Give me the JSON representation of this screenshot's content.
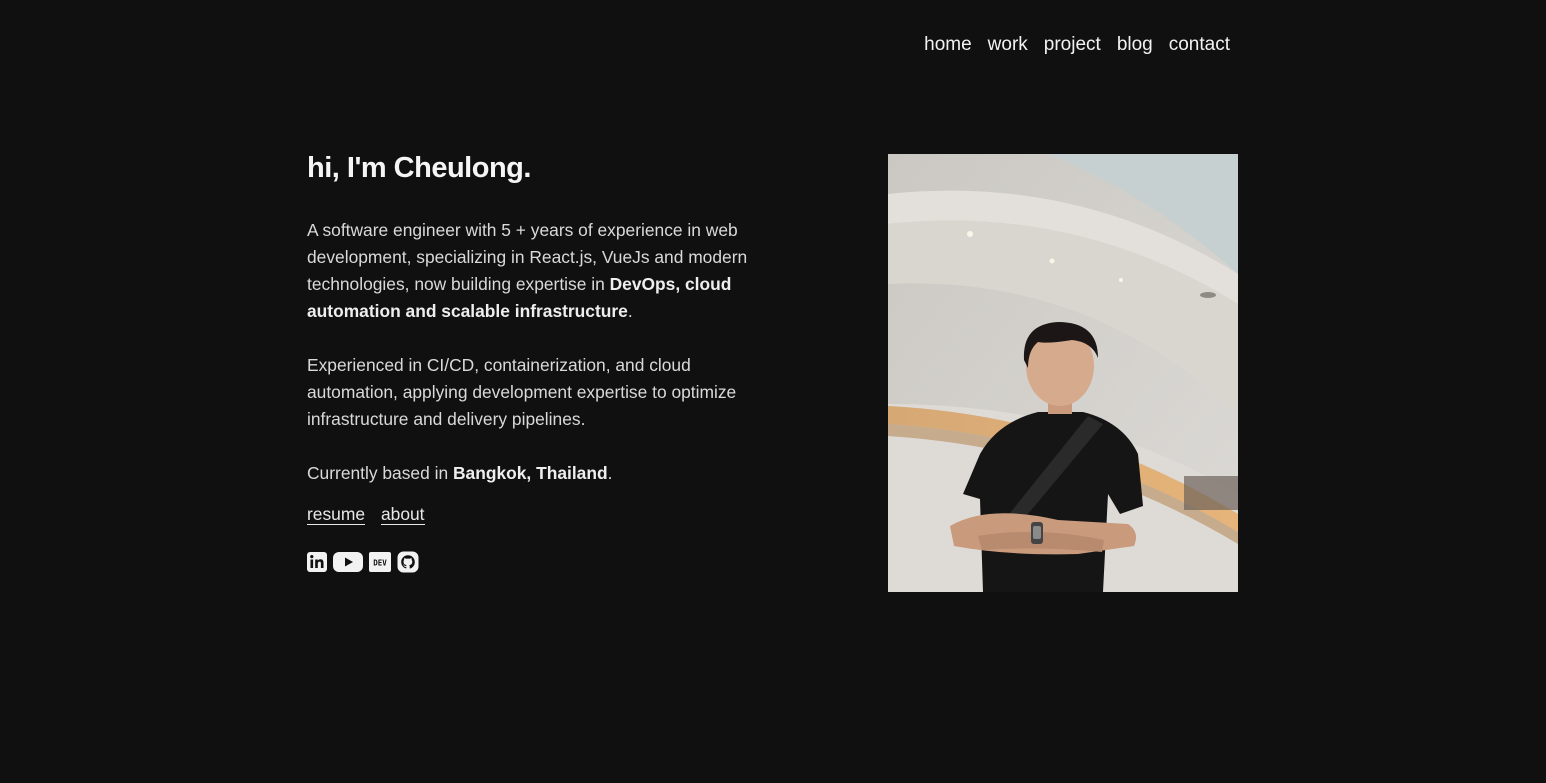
{
  "nav": {
    "items": [
      "home",
      "work",
      "project",
      "blog",
      "contact"
    ]
  },
  "intro": {
    "heading": "hi, I'm Cheulong.",
    "p1_text": "A software engineer with 5 + years of experience in web development, specializing in React.js, VueJs and modern technologies, now building expertise in ",
    "p1_bold": "DevOps, cloud automation and scalable infrastructure",
    "p1_end": ".",
    "p2": "Experienced in CI/CD, containerization, and cloud automation, applying development expertise to optimize infrastructure and delivery pipelines.",
    "loc_text": "Currently based in ",
    "loc_bold": "Bangkok, Thailand",
    "loc_end": "."
  },
  "links": {
    "resume": "resume",
    "about": "about"
  },
  "socials": {
    "icons": [
      "linkedin-icon",
      "youtube-icon",
      "dev-icon",
      "github-icon"
    ],
    "dev_label": "DEV"
  },
  "colors": {
    "background": "#101010",
    "text": "#e6e6e6"
  }
}
